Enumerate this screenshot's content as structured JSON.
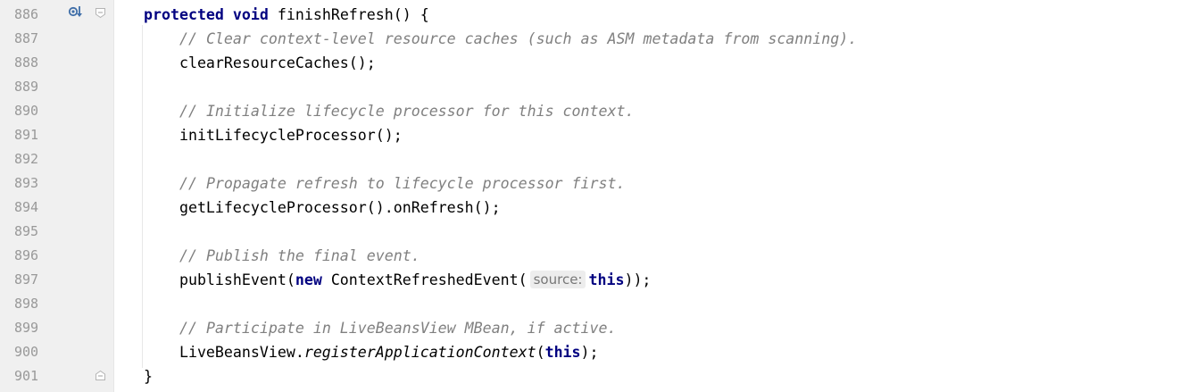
{
  "editor": {
    "lines": [
      {
        "num": "886",
        "segments": [
          {
            "t": "protected",
            "c": "kw"
          },
          {
            "t": " ",
            "c": ""
          },
          {
            "t": "void",
            "c": "kw"
          },
          {
            "t": " finishRefresh() {",
            "c": ""
          }
        ]
      },
      {
        "num": "887",
        "segments": [
          {
            "t": "    ",
            "c": ""
          },
          {
            "t": "// Clear context-level resource caches (such as ASM metadata from scanning).",
            "c": "cm"
          }
        ]
      },
      {
        "num": "888",
        "segments": [
          {
            "t": "    clearResourceCaches();",
            "c": ""
          }
        ]
      },
      {
        "num": "889",
        "segments": []
      },
      {
        "num": "890",
        "segments": [
          {
            "t": "    ",
            "c": ""
          },
          {
            "t": "// Initialize lifecycle processor for this context.",
            "c": "cm"
          }
        ]
      },
      {
        "num": "891",
        "segments": [
          {
            "t": "    initLifecycleProcessor();",
            "c": ""
          }
        ]
      },
      {
        "num": "892",
        "segments": []
      },
      {
        "num": "893",
        "segments": [
          {
            "t": "    ",
            "c": ""
          },
          {
            "t": "// Propagate refresh to lifecycle processor first.",
            "c": "cm"
          }
        ]
      },
      {
        "num": "894",
        "segments": [
          {
            "t": "    getLifecycleProcessor().onRefresh();",
            "c": ""
          }
        ]
      },
      {
        "num": "895",
        "segments": []
      },
      {
        "num": "896",
        "segments": [
          {
            "t": "    ",
            "c": ""
          },
          {
            "t": "// Publish the final event.",
            "c": "cm"
          }
        ]
      },
      {
        "num": "897",
        "segments": [
          {
            "t": "    publishEvent(",
            "c": ""
          },
          {
            "t": "new",
            "c": "kw"
          },
          {
            "t": " ContextRefreshedEvent(",
            "c": ""
          },
          {
            "t": "source:",
            "c": "hint"
          },
          {
            "t": "this",
            "c": "kw"
          },
          {
            "t": "));",
            "c": ""
          }
        ]
      },
      {
        "num": "898",
        "segments": []
      },
      {
        "num": "899",
        "segments": [
          {
            "t": "    ",
            "c": ""
          },
          {
            "t": "// Participate in LiveBeansView MBean, if active.",
            "c": "cm"
          }
        ]
      },
      {
        "num": "900",
        "segments": [
          {
            "t": "    LiveBeansView.",
            "c": ""
          },
          {
            "t": "registerApplicationContext",
            "c": "it"
          },
          {
            "t": "(",
            "c": ""
          },
          {
            "t": "this",
            "c": "kw"
          },
          {
            "t": ");",
            "c": ""
          }
        ]
      },
      {
        "num": "901",
        "segments": [
          {
            "t": "}",
            "c": ""
          }
        ]
      }
    ]
  },
  "gutter_icons": {
    "override": "override-method-icon",
    "fold_open": "fold-open-icon",
    "fold_close": "fold-close-icon"
  },
  "colors": {
    "keyword": "#000080",
    "comment": "#808080",
    "line_number": "#999999",
    "gutter_bg": "#f0f0f0",
    "override_icon": "#3f6ea8"
  }
}
